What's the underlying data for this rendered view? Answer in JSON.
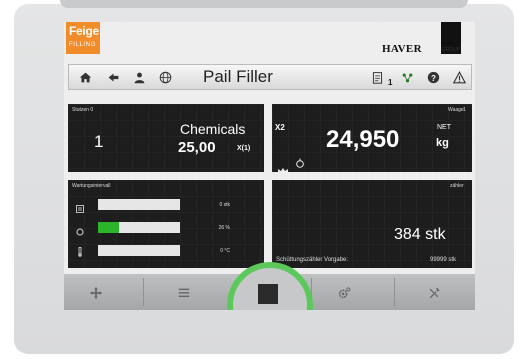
{
  "brand": {
    "line1": "Feige",
    "line2": "FILLING",
    "color": "#f28c28"
  },
  "logo": {
    "name": "HAVER",
    "suffix": "GROUP"
  },
  "toolbar": {
    "title": "Pail Filler",
    "subscript": "1",
    "icons": [
      "home-icon",
      "back-arrow-icon",
      "user-icon",
      "globe-icon",
      "clipboard-icon",
      "network-icon",
      "help-icon",
      "warning-icon"
    ]
  },
  "stutzen": {
    "label": "Stutzen 0",
    "index": "1",
    "product": "Chemicals",
    "value": "25,00",
    "unit": "X(1)"
  },
  "waage": {
    "label": "Waage",
    "number": "1",
    "x2": "X2",
    "weight": "24,950",
    "mode": "NET",
    "unit": "kg"
  },
  "wartung": {
    "label": "Wartungsintervall",
    "rows": [
      {
        "icon": "counter-icon",
        "value": "0 stk",
        "fraction": 0.0
      },
      {
        "icon": "cycle-icon",
        "value": "26 %",
        "fraction": 0.26
      },
      {
        "icon": "thermometer-icon",
        "value": "0 °C",
        "fraction": 0.0
      }
    ]
  },
  "zaehler": {
    "label": "zähler",
    "count": "384 stk",
    "preset_label": "Schüttungszähler Vorgabe:",
    "preset_value": "99999 stk"
  },
  "bottom_nav": [
    "move-icon",
    "list-icon",
    "stop-button",
    "settings-icon",
    "tools-icon"
  ],
  "accent": "#2bb52b"
}
